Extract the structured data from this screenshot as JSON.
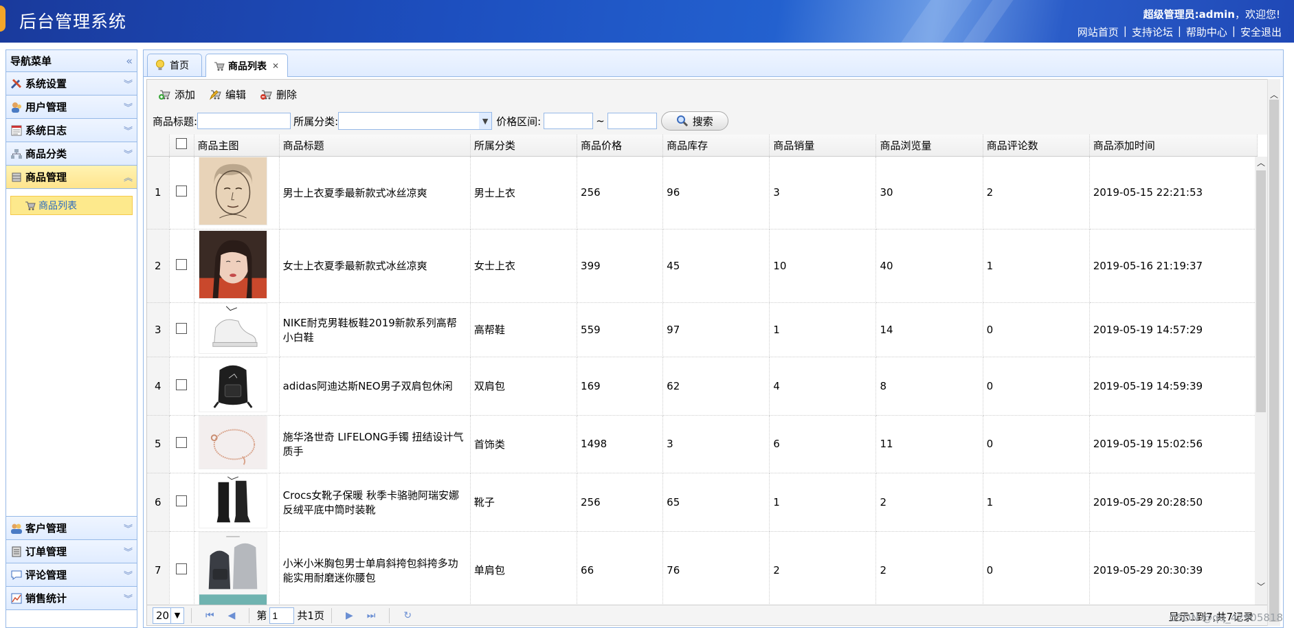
{
  "header": {
    "title": "后台管理系统",
    "welcome_user": "超级管理员:admin",
    "welcome_suffix": "，欢迎您!",
    "links": [
      "网站首页",
      "支持论坛",
      "帮助中心",
      "安全退出"
    ]
  },
  "sidebar": {
    "title": "导航菜单",
    "groups_top": [
      {
        "label": "系统设置",
        "icon": "tools-icon"
      },
      {
        "label": "用户管理",
        "icon": "users-icon"
      },
      {
        "label": "系统日志",
        "icon": "log-icon"
      },
      {
        "label": "商品分类",
        "icon": "category-icon"
      },
      {
        "label": "商品管理",
        "icon": "goods-icon",
        "active": true
      }
    ],
    "active_sub": "商品列表",
    "groups_bottom": [
      {
        "label": "客户管理",
        "icon": "customers-icon"
      },
      {
        "label": "订单管理",
        "icon": "orders-icon"
      },
      {
        "label": "评论管理",
        "icon": "comments-icon"
      },
      {
        "label": "销售统计",
        "icon": "chart-icon"
      }
    ]
  },
  "tabs": [
    {
      "label": "首页",
      "icon": "bulb-icon"
    },
    {
      "label": "商品列表",
      "icon": "cart-icon",
      "closable": true
    }
  ],
  "toolbar": {
    "add": "添加",
    "edit": "编辑",
    "delete": "删除"
  },
  "search": {
    "title_label": "商品标题:",
    "category_label": "所属分类:",
    "price_label": "价格区间:",
    "tilde": "~",
    "button": "搜索"
  },
  "table": {
    "columns": [
      "商品主图",
      "商品标题",
      "所属分类",
      "商品价格",
      "商品库存",
      "商品销量",
      "商品浏览量",
      "商品评论数",
      "商品添加时间"
    ],
    "rows": [
      {
        "n": "1",
        "title": "男士上衣夏季最新款式冰丝凉爽",
        "category": "男士上衣",
        "price": "256",
        "stock": "96",
        "sales": "3",
        "views": "30",
        "comments": "2",
        "time": "2019-05-15 22:21:53",
        "image": "portrait-sketch"
      },
      {
        "n": "2",
        "title": "女士上衣夏季最新款式冰丝凉爽",
        "category": "女士上衣",
        "price": "399",
        "stock": "45",
        "sales": "10",
        "views": "40",
        "comments": "1",
        "time": "2019-05-16 21:19:37",
        "image": "portrait-woman"
      },
      {
        "n": "3",
        "title": "NIKE耐克男鞋板鞋2019新款系列高帮小白鞋",
        "category": "高帮鞋",
        "price": "559",
        "stock": "97",
        "sales": "1",
        "views": "14",
        "comments": "0",
        "time": "2019-05-19 14:57:29",
        "image": "white-sneaker"
      },
      {
        "n": "4",
        "title": "adidas阿迪达斯NEO男子双肩包休闲",
        "category": "双肩包",
        "price": "169",
        "stock": "62",
        "sales": "4",
        "views": "8",
        "comments": "0",
        "time": "2019-05-19 14:59:39",
        "image": "black-backpack"
      },
      {
        "n": "5",
        "title": "施华洛世奇 LIFELONG手镯 扭结设计气质手",
        "category": "首饰类",
        "price": "1498",
        "stock": "3",
        "sales": "6",
        "views": "11",
        "comments": "0",
        "time": "2019-05-19 15:02:56",
        "image": "bracelet"
      },
      {
        "n": "6",
        "title": "Crocs女靴子保暖 秋季卡骆驰阿瑞安娜反绒平底中筒时装靴",
        "category": "靴子",
        "price": "256",
        "stock": "65",
        "sales": "1",
        "views": "2",
        "comments": "1",
        "time": "2019-05-29 20:28:50",
        "image": "boots"
      },
      {
        "n": "7",
        "title": "小米小米胸包男士单肩斜挎包斜挎多功能实用耐磨迷你腰包",
        "category": "单肩包",
        "price": "66",
        "stock": "76",
        "sales": "2",
        "views": "2",
        "comments": "0",
        "time": "2019-05-29 20:30:39",
        "image": "chest-bags"
      }
    ]
  },
  "pager": {
    "page_size": "20",
    "page_prefix": "第",
    "page_value": "1",
    "page_total": "共1页",
    "info": "显示1到7,共7记录"
  },
  "watermark": "CSDN @qq_42905818"
}
